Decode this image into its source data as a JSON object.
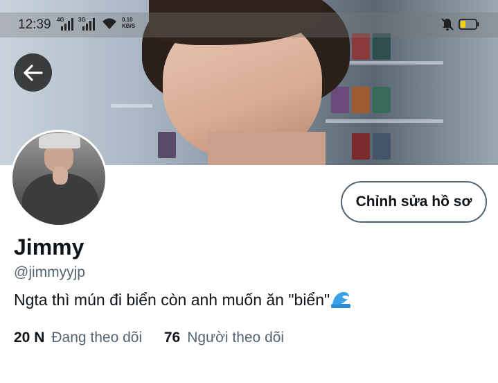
{
  "status_bar": {
    "time": "12:39",
    "network_1": "4G",
    "network_2": "3G",
    "speed_value": "0.10",
    "speed_unit": "KB/S"
  },
  "profile": {
    "edit_button_label": "Chỉnh sửa hồ sơ",
    "display_name": "Jimmy",
    "handle": "@jimmyyjp",
    "bio": "Ngta thì mún đi biển còn anh muốn ăn \"biển\"",
    "bio_emoji": "wave-icon",
    "following_count": "20 N",
    "following_label": "Đang theo dõi",
    "followers_count": "76",
    "followers_label": "Người theo dõi"
  },
  "colors": {
    "primary_text": "#0f1419",
    "secondary_text": "#536471",
    "battery_fill": "#f5d10a"
  }
}
